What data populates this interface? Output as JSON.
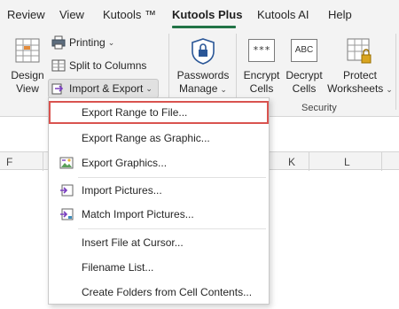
{
  "tabs": [
    {
      "label": "Review"
    },
    {
      "label": "View"
    },
    {
      "label": "Kutools ™"
    },
    {
      "label": "Kutools Plus"
    },
    {
      "label": "Kutools AI"
    },
    {
      "label": "Help"
    }
  ],
  "active_tab": "Kutools Plus",
  "ribbon": {
    "design_view": {
      "line1": "Design",
      "line2": "View"
    },
    "printing": "Printing",
    "split_to_columns": "Split to Columns",
    "import_export": "Import & Export",
    "passwords_manage": {
      "line1": "Passwords",
      "line2": "Manage"
    },
    "encrypt_cells": {
      "line1": "Encrypt",
      "line2": "Cells",
      "icon_text": "***"
    },
    "decrypt_cells": {
      "line1": "Decrypt",
      "line2": "Cells",
      "icon_text": "ABC"
    },
    "protect_worksheets": {
      "line1": "Protect",
      "line2": "Worksheets"
    },
    "security_group": "Security"
  },
  "columns": [
    "F",
    "K",
    "L"
  ],
  "menu": {
    "items": [
      {
        "label": "Export Range to File...",
        "icon": "none",
        "selected": true
      },
      {
        "label": "Export Range as Graphic...",
        "icon": "none"
      },
      {
        "label": "Export Graphics...",
        "icon": "export-graphics-icon"
      },
      {
        "label": "Import Pictures...",
        "icon": "import-pictures-icon"
      },
      {
        "label": "Match Import Pictures...",
        "icon": "match-import-pictures-icon"
      },
      {
        "label": "Insert File at Cursor...",
        "icon": "none"
      },
      {
        "label": "Filename List...",
        "icon": "none"
      },
      {
        "label": "Create Folders from Cell Contents...",
        "icon": "none"
      }
    ]
  },
  "colors": {
    "accent_green": "#217346",
    "selection_outline": "#d9534f",
    "ribbon_bg": "#f3f3f3"
  }
}
